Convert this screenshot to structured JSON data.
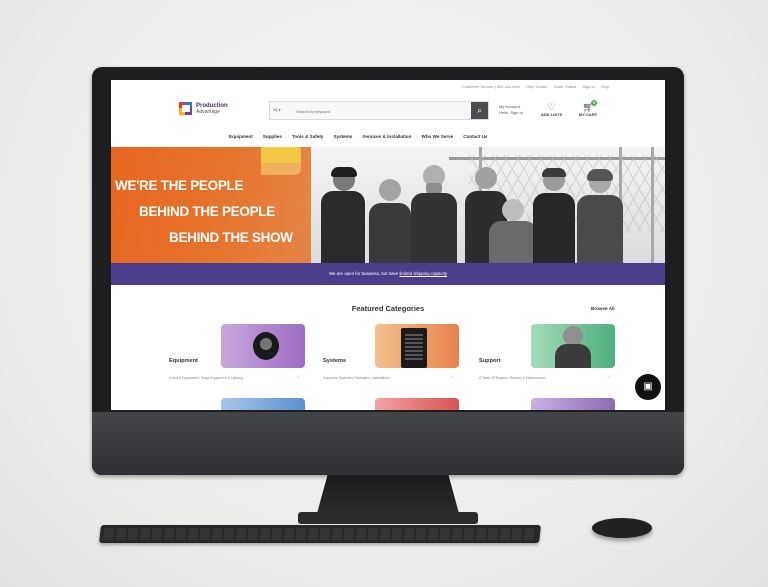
{
  "utility_links": [
    "Customer Service | 800-xxx-xxxx",
    "Help Center",
    "Order Status",
    "Sign In",
    "Help"
  ],
  "brand": {
    "name": "Production",
    "tagline": "Advantage"
  },
  "search": {
    "category": "All",
    "placeholder": "Search by keyword",
    "icon": "search-icon"
  },
  "account": {
    "greeting": "My Account",
    "subtext": "Hello, Sign In"
  },
  "wishlist_label": "ADD LISTS",
  "cart": {
    "label": "MY CART",
    "count": "0"
  },
  "nav": [
    "Equipment",
    "Supplies",
    "Tools & Safety",
    "Systems",
    "Services & Installation",
    "Who We Serve",
    "Contact Us"
  ],
  "hero": {
    "line1": "WE'RE THE PEOPLE",
    "line2": "BEHIND THE PEOPLE",
    "line3": "BEHIND THE SHOW"
  },
  "notice": {
    "text": "We are open for business, but have",
    "link": "limited shipping capacity"
  },
  "featured": {
    "title": "Featured Categories",
    "browse_all": "Browse All",
    "cards": [
      {
        "label": "Equipment",
        "sub": "Concert Equipment | Stage Equipment & Lighting",
        "color": "#8c6bb1"
      },
      {
        "label": "Systems",
        "sub": "Complete Systems | Packages | Installations",
        "color": "#e8834a"
      },
      {
        "label": "Support",
        "sub": "A Team Of Experts | Repairs & Maintenance",
        "color": "#4caf7d"
      }
    ]
  },
  "colors": {
    "orange": "#e8651f",
    "purple_bar": "#4b3d8c",
    "brand_purple": "#4b2a72"
  }
}
